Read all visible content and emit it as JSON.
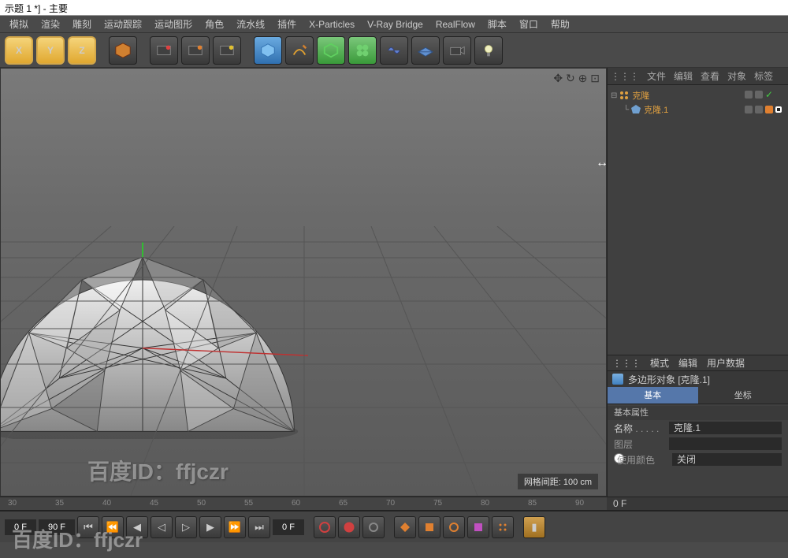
{
  "title": "示题 1 *] - 主要",
  "menu": [
    "模拟",
    "渲染",
    "雕刻",
    "运动跟踪",
    "运动图形",
    "角色",
    "流水线",
    "插件",
    "X-Particles",
    "V-Ray Bridge",
    "RealFlow",
    "脚本",
    "窗口",
    "帮助"
  ],
  "toolbar_xyz": [
    "X",
    "Y",
    "Z"
  ],
  "viewport": {
    "grid_info": "网格间距: 100 cm",
    "watermark": "百度ID：ffjczr"
  },
  "objects_panel": {
    "tabs": [
      "文件",
      "编辑",
      "查看",
      "对象",
      "标签"
    ],
    "tree": [
      {
        "name": "克隆",
        "indent": 0,
        "expanded": true
      },
      {
        "name": "克隆.1",
        "indent": 1,
        "expanded": false
      }
    ]
  },
  "attributes_panel": {
    "tabs": [
      "模式",
      "编辑",
      "用户数据"
    ],
    "title": "多边形对象 [克隆.1]",
    "tab_basic": "基本",
    "tab_coord": "坐标",
    "section_header": "基本属性",
    "props": {
      "name_label": "名称",
      "name_value": "克隆.1",
      "layer_label": "图层",
      "layer_value": "",
      "usecolor_label": "使用颜色",
      "usecolor_value": "关闭"
    }
  },
  "timeline": {
    "ticks": [
      "30",
      "35",
      "40",
      "45",
      "50",
      "55",
      "60",
      "65",
      "70",
      "75",
      "80",
      "85",
      "90"
    ],
    "frame_start": "0 F",
    "frame_cur": "0 F",
    "frame_end": "90 F"
  },
  "resize_cursor": "↔"
}
